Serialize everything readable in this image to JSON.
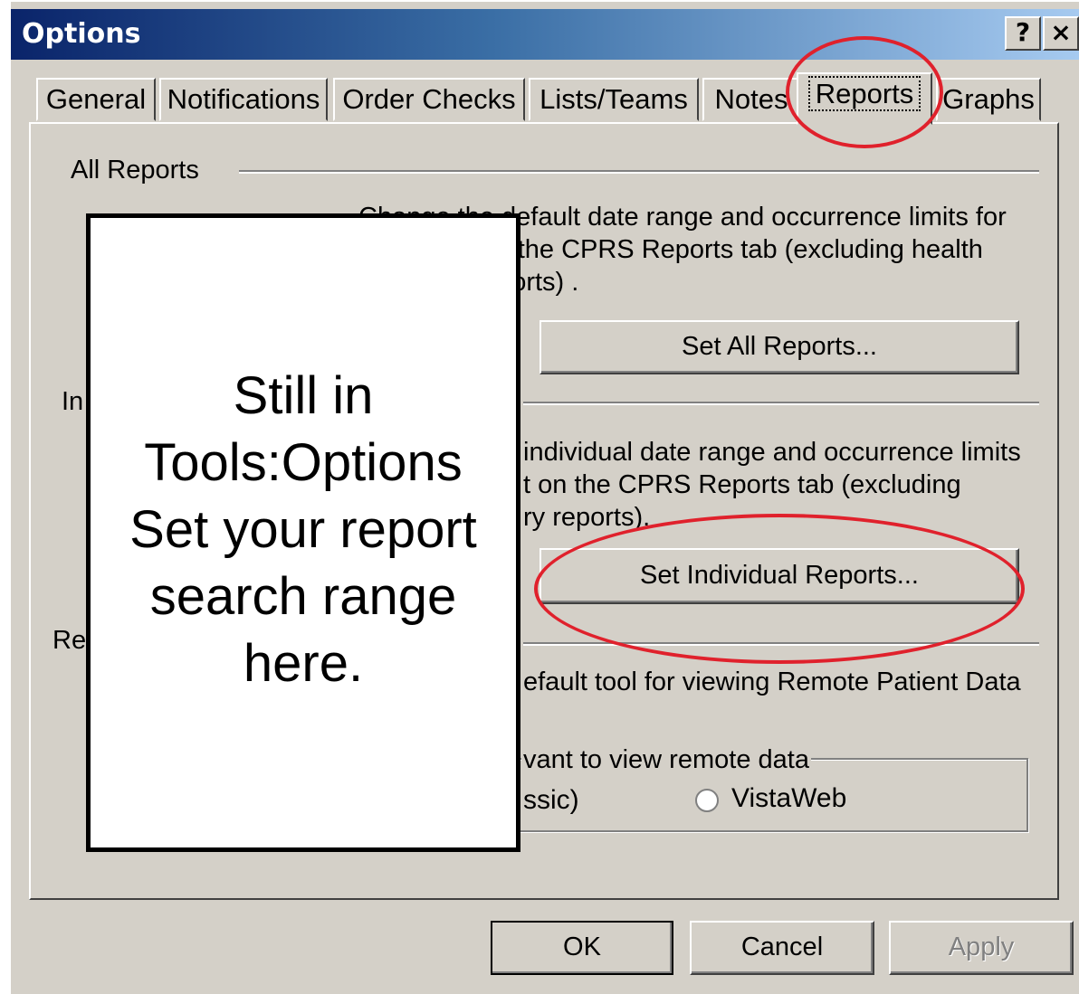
{
  "window": {
    "title": "Options",
    "help_label": "?",
    "close_label": "×"
  },
  "tabs": [
    {
      "label": "General",
      "active": false
    },
    {
      "label": "Notifications",
      "active": false
    },
    {
      "label": "Order Checks",
      "active": false
    },
    {
      "label": "Lists/Teams",
      "active": false
    },
    {
      "label": "Notes",
      "active": false
    },
    {
      "label": "Reports",
      "active": true
    },
    {
      "label": "Graphs",
      "active": false
    }
  ],
  "all_reports": {
    "group_label": "All Reports",
    "desc_lines": [
      "Change the default date range and occurrence limits for",
      "all reports on the CPRS Reports tab (excluding health",
      "summary reports) ."
    ],
    "button_label": "Set All Reports..."
  },
  "individual_reports": {
    "group_label": "In",
    "desc_lines": [
      "individual date range and occurrence limits",
      "t on the CPRS Reports tab (excluding",
      "ry reports)."
    ],
    "button_label": "Set Individual Reports..."
  },
  "remote": {
    "group_label": "Re",
    "desc_line": "efault tool for viewing Remote Patient Data",
    "legend": "vant to view remote data",
    "option_classic": "ssic)",
    "option_vistaweb": "VistaWeb"
  },
  "buttons": {
    "ok": "OK",
    "cancel": "Cancel",
    "apply": "Apply"
  },
  "callout": {
    "lines": [
      "Still in",
      "Tools:Options",
      "Set your report",
      "search range",
      "here."
    ]
  },
  "colors": {
    "title_gradient_start": "#0a246a",
    "title_gradient_end": "#a6caf0",
    "dialog_face": "#d4d0c8",
    "highlight_circle": "#e0212c"
  }
}
